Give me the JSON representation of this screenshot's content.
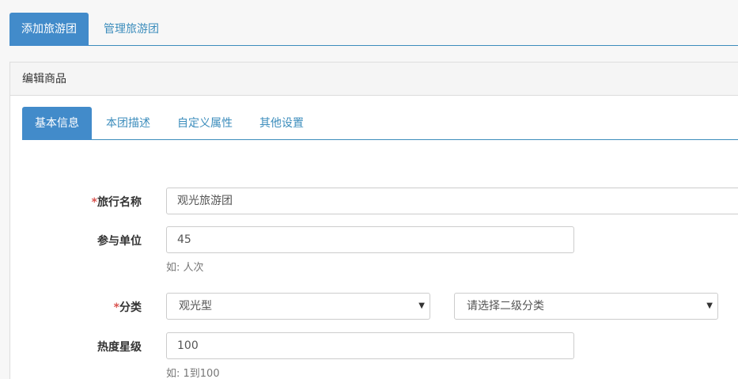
{
  "top_tabs": {
    "add": "添加旅游团",
    "manage": "管理旅游团"
  },
  "panel": {
    "heading": "编辑商品"
  },
  "inner_tabs": {
    "basic": "基本信息",
    "desc": "本团描述",
    "custom": "自定义属性",
    "other": "其他设置"
  },
  "form": {
    "name": {
      "required_mark": "*",
      "label": "旅行名称",
      "value": "观光旅游团"
    },
    "unit": {
      "label": "参与单位",
      "value": "45",
      "help": "如: 人次"
    },
    "category": {
      "required_mark": "*",
      "label": "分类",
      "primary_value": "观光型",
      "secondary_value": "请选择二级分类"
    },
    "heat": {
      "label": "热度星级",
      "value": "100",
      "help": "如: 1到100"
    }
  },
  "icons": {
    "select_caret": "caret-down-icon"
  }
}
